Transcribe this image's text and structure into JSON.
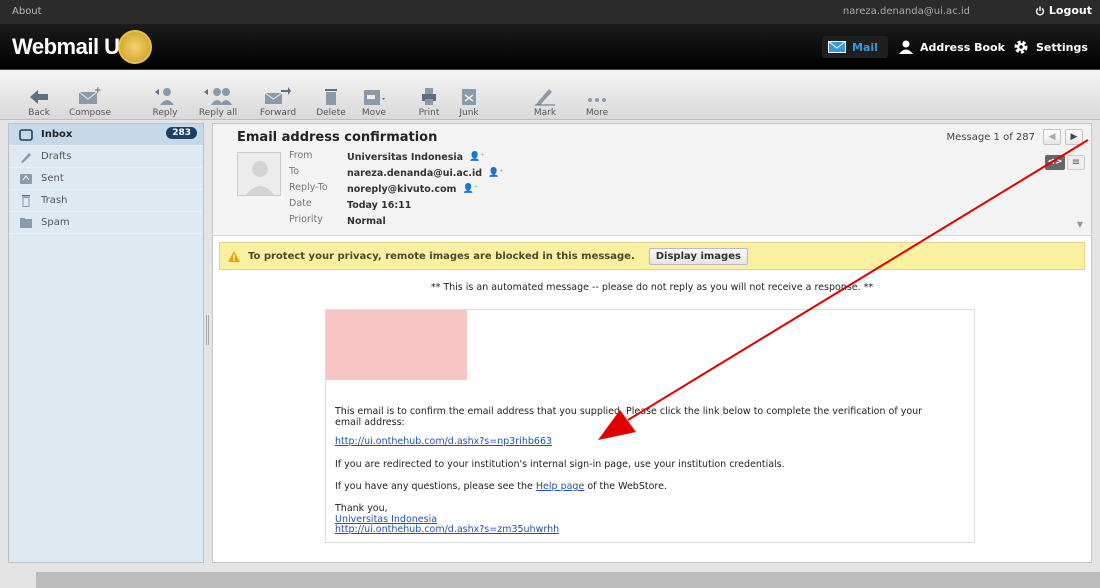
{
  "topbar": {
    "about": "About",
    "user": "nareza.denanda@ui.ac.id",
    "logout": "Logout"
  },
  "app": {
    "logo": "Webmail UI"
  },
  "nav": {
    "mail": "Mail",
    "address_book": "Address Book",
    "settings": "Settings"
  },
  "toolbar": {
    "back": "Back",
    "compose": "Compose",
    "reply": "Reply",
    "reply_all": "Reply all",
    "forward": "Forward",
    "delete": "Delete",
    "move": "Move",
    "print": "Print",
    "junk": "Junk",
    "mark": "Mark",
    "more": "More"
  },
  "folders": [
    {
      "label": "Inbox",
      "count": "283"
    },
    {
      "label": "Drafts"
    },
    {
      "label": "Sent"
    },
    {
      "label": "Trash"
    },
    {
      "label": "Spam"
    }
  ],
  "message": {
    "subject": "Email address confirmation",
    "counter": "Message 1 of 287",
    "headers": {
      "from_label": "From",
      "from": "Universitas Indonesia",
      "to_label": "To",
      "to": "nareza.denanda@ui.ac.id",
      "replyto_label": "Reply-To",
      "replyto": "noreply@kivuto.com",
      "date_label": "Date",
      "date": "Today 16:11",
      "priority_label": "Priority",
      "priority": "Normal"
    },
    "privacy_warning": "To protect your privacy, remote images are blocked in this message.",
    "display_images": "Display images",
    "auto_note": "** This is an automated message -- please do not reply as you will not receive a response. **",
    "body": {
      "p1": "This email is to confirm the email address that you supplied. Please click the link below to complete the verification of your email address:",
      "link1": "http://ui.onthehub.com/d.ashx?s=np3rihb663",
      "p2": "If you are redirected to your institution's internal sign-in page, use your institution credentials.",
      "p3_pre": "If you have any questions, please see the ",
      "p3_link": "Help page",
      "p3_post": " of the WebStore.",
      "thanks": "Thank you,",
      "sig_name": "Universitas Indonesia",
      "sig_link": "http://ui.onthehub.com/d.ashx?s=zm35uhwrhh"
    }
  },
  "colors": {
    "annotation_arrow": "#e00000",
    "warning_bg": "#faf0a1",
    "sidebar_bg": "#dfe9f2"
  }
}
